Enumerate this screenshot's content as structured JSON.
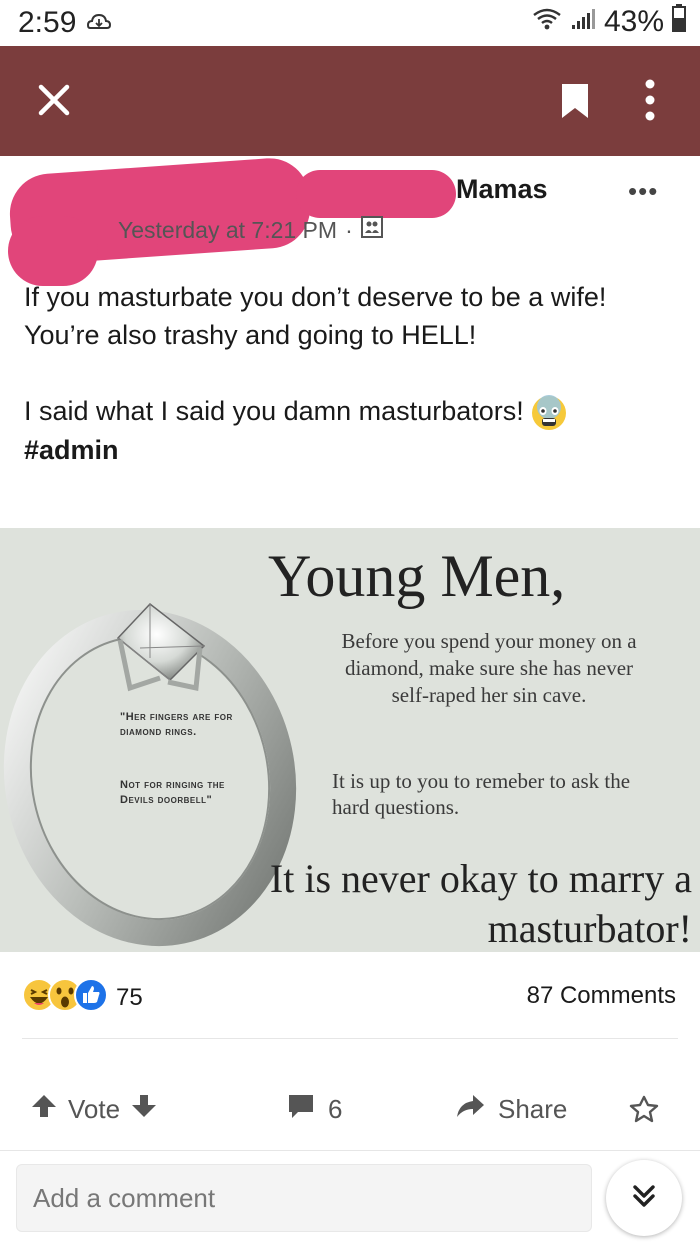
{
  "status_bar": {
    "time": "2:59",
    "battery": "43%",
    "icons": [
      "notification-icon",
      "wifi-icon",
      "signal-icon",
      "battery-icon"
    ]
  },
  "toolbar": {
    "icons": [
      "close-icon",
      "bookmark-icon",
      "more-vertical-icon"
    ],
    "background": "#7b3d3d"
  },
  "post": {
    "group_name": "Mamas",
    "timestamp": "Yesterday at 7:21 PM",
    "separator": "·",
    "visibility_icon": "public-group-icon",
    "more_label": "•••",
    "body": {
      "line1": "If you masturbate you don’t deserve to be a wife! You’re also trashy and going to HELL!",
      "line2": "I said what I said you damn masturbators!",
      "emoji": "fearful-face-emoji",
      "hashtag": "#admin"
    },
    "image": {
      "title": "Young Men,",
      "paragraph_1": "Before you spend your money on a diamond, make sure she has never self-raped her sin cave.",
      "paragraph_2": "It is up to you to remeber to ask the hard questions.",
      "paragraph_3": "It is never okay to marry a masturbator!",
      "quote_1": "\"Her fingers are for diamond rings.",
      "quote_2": "Not for ringing the Devils doorbell\""
    }
  },
  "engagement": {
    "reaction_icons": [
      "laughing-reaction-icon",
      "wow-reaction-icon",
      "like-reaction-icon"
    ],
    "reaction_count": "75",
    "comments": "87 Comments"
  },
  "actions": {
    "vote": "Vote",
    "comment_count": "6",
    "share": "Share"
  },
  "composer": {
    "placeholder": "Add a comment"
  }
}
